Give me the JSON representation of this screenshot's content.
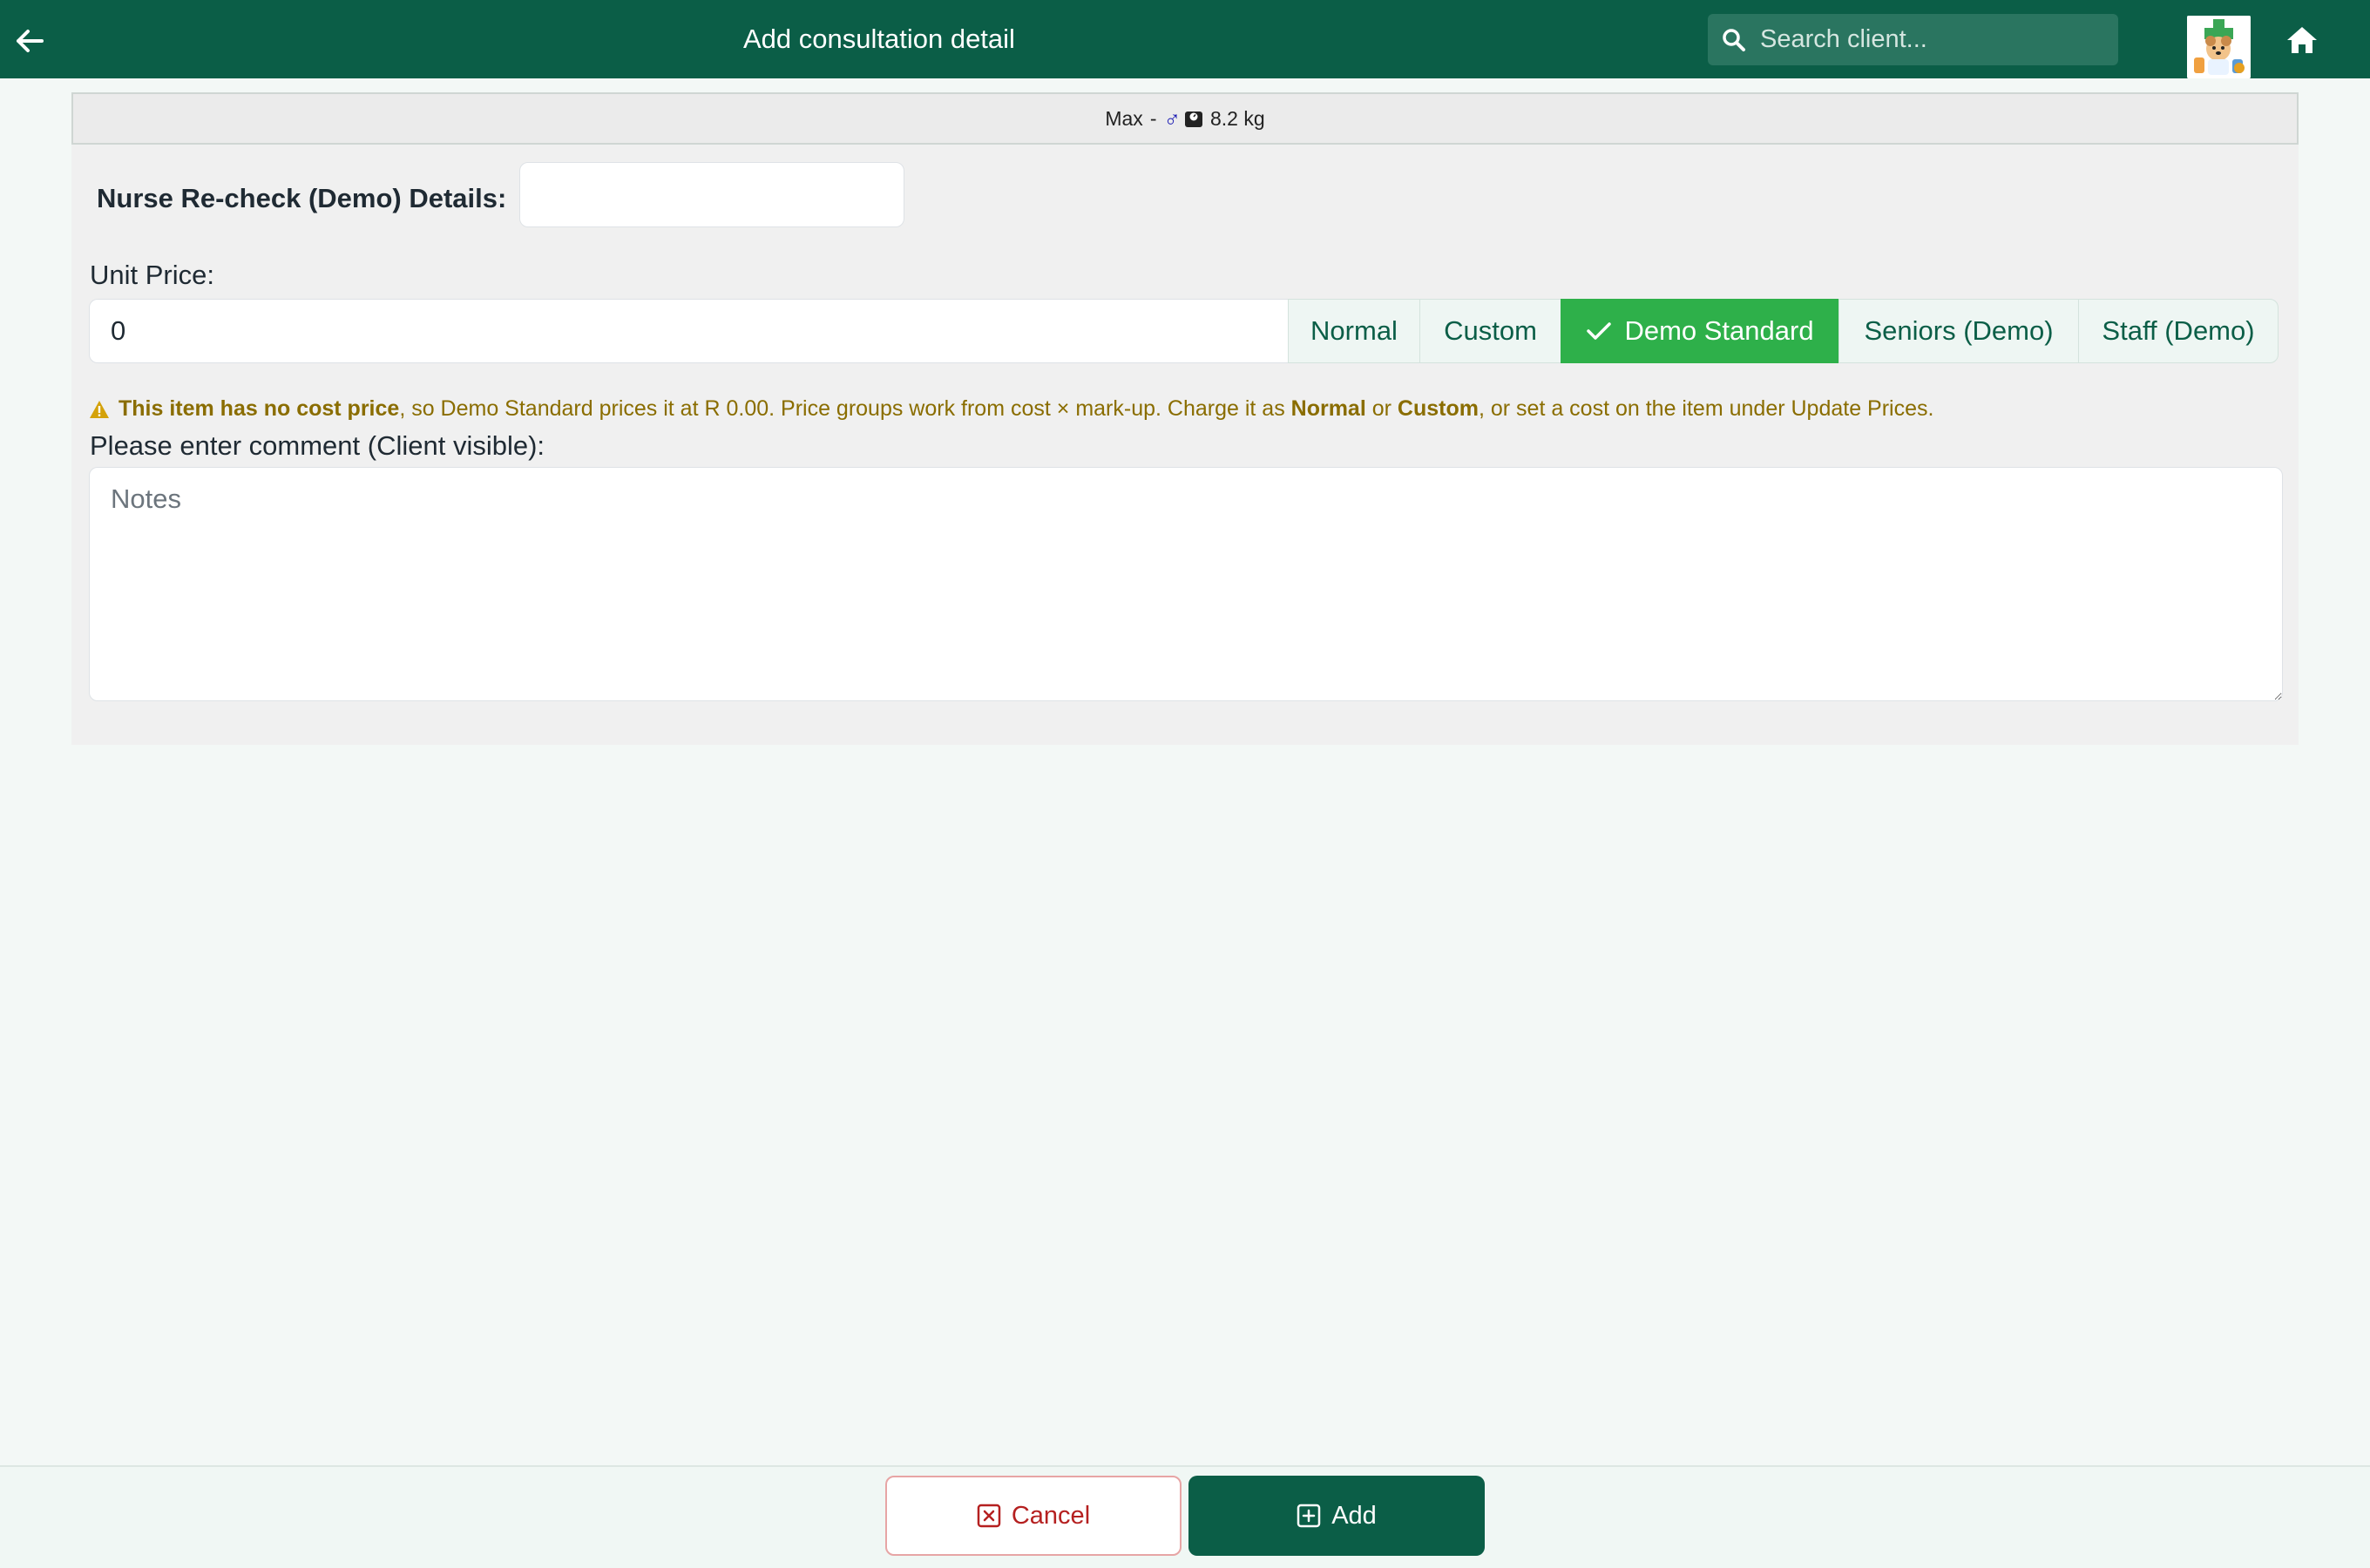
{
  "header": {
    "title": "Add consultation detail",
    "search_placeholder": "Search client...",
    "back_icon": "arrow-left-icon",
    "home_icon": "home-icon"
  },
  "patient": {
    "name": "Max",
    "separator": "-",
    "sex_symbol": "♂",
    "weight": "8.2 kg"
  },
  "form": {
    "details_label": "Nurse Re-check (Demo) Details:",
    "details_value": "",
    "unit_price_label": "Unit Price:",
    "unit_price_value": "0",
    "price_groups": {
      "normal": "Normal",
      "custom": "Custom",
      "demo_standard": "Demo Standard",
      "seniors": "Seniors (Demo)",
      "staff": "Staff (Demo)"
    },
    "selected_price_group": "Demo Standard",
    "warning": {
      "bold_lead": "This item has no cost price",
      "text1": ", so Demo Standard prices it at R 0.00. Price groups work from cost × mark-up. Charge it as ",
      "bold_normal": "Normal",
      "text2": " or ",
      "bold_custom": "Custom",
      "text3": ", or set a cost on the item under Update Prices."
    },
    "comment_label": "Please enter comment (Client visible):",
    "comment_placeholder": "Notes",
    "comment_value": ""
  },
  "footer": {
    "cancel_label": "Cancel",
    "add_label": "Add"
  },
  "colors": {
    "header_bg": "#0b5e47",
    "selected_group": "#2eb04a",
    "warning_text": "#8a6d00",
    "cancel_text": "#b52020"
  }
}
